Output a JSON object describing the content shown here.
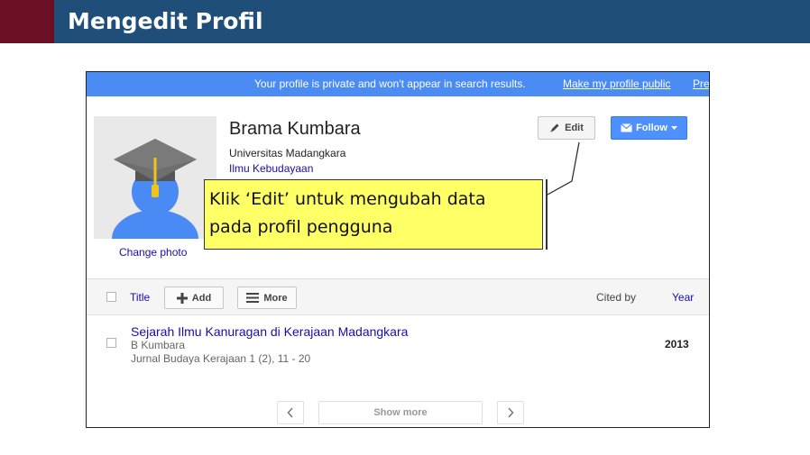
{
  "slide": {
    "title": "Mengedit Profil"
  },
  "colors": {
    "header": "#1f4e79",
    "accent": "#6b0f24",
    "banner": "#4b8bf4",
    "callout": "#ffff66",
    "link": "#1a0dab"
  },
  "banner": {
    "message": "Your profile is private and won't appear in search results.",
    "make_public": "Make my profile public",
    "cut_link": "Pre"
  },
  "profile": {
    "name": "Brama Kumbara",
    "affiliation": "Universitas Madangkara",
    "interest": "Ilmu Kebudayaan",
    "change_photo": "Change photo",
    "avatar_icon": "graduation-cap-avatar"
  },
  "buttons": {
    "edit": "Edit",
    "follow": "Follow"
  },
  "callout": {
    "line1": "Klik ‘Edit’ untuk mengubah data",
    "line2": "pada profil pengguna"
  },
  "table": {
    "title_col": "Title",
    "add": "Add",
    "more": "More",
    "cited_by": "Cited by",
    "year": "Year"
  },
  "articles": [
    {
      "title": "Sejarah Ilmu Kanuragan di Kerajaan Madangkara",
      "authors": "B Kumbara",
      "journal": "Jurnal Budaya Kerajaan 1 (2), 11 - 20",
      "year": "2013"
    }
  ],
  "pager": {
    "prev_icon": "chevron-left",
    "show_more": "Show more",
    "next_icon": "chevron-right"
  }
}
